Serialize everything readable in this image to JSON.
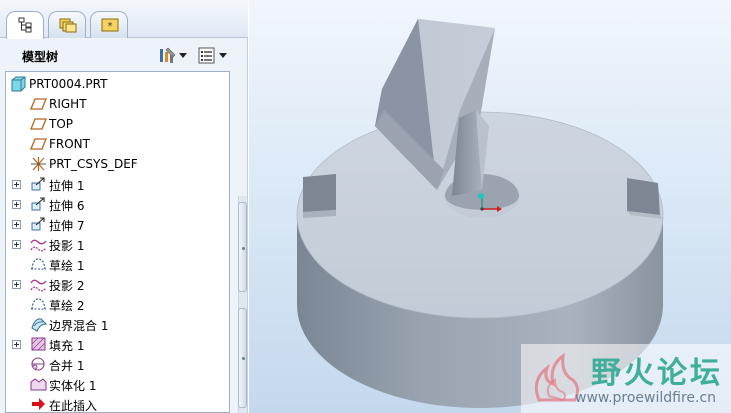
{
  "navigator": {
    "tabs": [
      {
        "icon": "model-tree-icon",
        "active": true
      },
      {
        "icon": "folder-browser-icon",
        "active": false
      },
      {
        "icon": "favorites-icon",
        "active": false
      }
    ],
    "title": "模型树",
    "settings_icon": "tree-settings-icon",
    "show_icon": "tree-show-icon"
  },
  "tree": {
    "items": [
      {
        "label": "PRT0004.PRT",
        "icon": "part-icon",
        "expandable": false,
        "root": true
      },
      {
        "label": "RIGHT",
        "icon": "datum-plane-icon",
        "expandable": false
      },
      {
        "label": "TOP",
        "icon": "datum-plane-icon",
        "expandable": false
      },
      {
        "label": "FRONT",
        "icon": "datum-plane-icon",
        "expandable": false
      },
      {
        "label": "PRT_CSYS_DEF",
        "icon": "csys-icon",
        "expandable": false
      },
      {
        "label": "拉伸 1",
        "icon": "extrude-icon",
        "expandable": true
      },
      {
        "label": "拉伸 6",
        "icon": "extrude-icon",
        "expandable": true
      },
      {
        "label": "拉伸 7",
        "icon": "extrude-icon",
        "expandable": true
      },
      {
        "label": "投影 1",
        "icon": "projection-icon",
        "expandable": true
      },
      {
        "label": "草绘 1",
        "icon": "sketch-icon",
        "expandable": false
      },
      {
        "label": "投影 2",
        "icon": "projection-icon",
        "expandable": true
      },
      {
        "label": "草绘 2",
        "icon": "sketch-icon",
        "expandable": false
      },
      {
        "label": "边界混合 1",
        "icon": "boundary-blend-icon",
        "expandable": false
      },
      {
        "label": "填充 1",
        "icon": "fill-icon",
        "expandable": true
      },
      {
        "label": "合并 1",
        "icon": "merge-icon",
        "expandable": false
      },
      {
        "label": "实体化 1",
        "icon": "solidify-icon",
        "expandable": false
      },
      {
        "label": "在此插入",
        "icon": "insert-here-icon",
        "expandable": false
      }
    ]
  },
  "watermark": {
    "text": "野火论坛",
    "url": "www.proewildfire.cn"
  },
  "colors": {
    "datum_plane": "#b5651d",
    "sketch": "#2a5d9f",
    "projection": "#b0308f",
    "insert_arrow": "#d8111b",
    "watermark": "#3fae9a"
  }
}
